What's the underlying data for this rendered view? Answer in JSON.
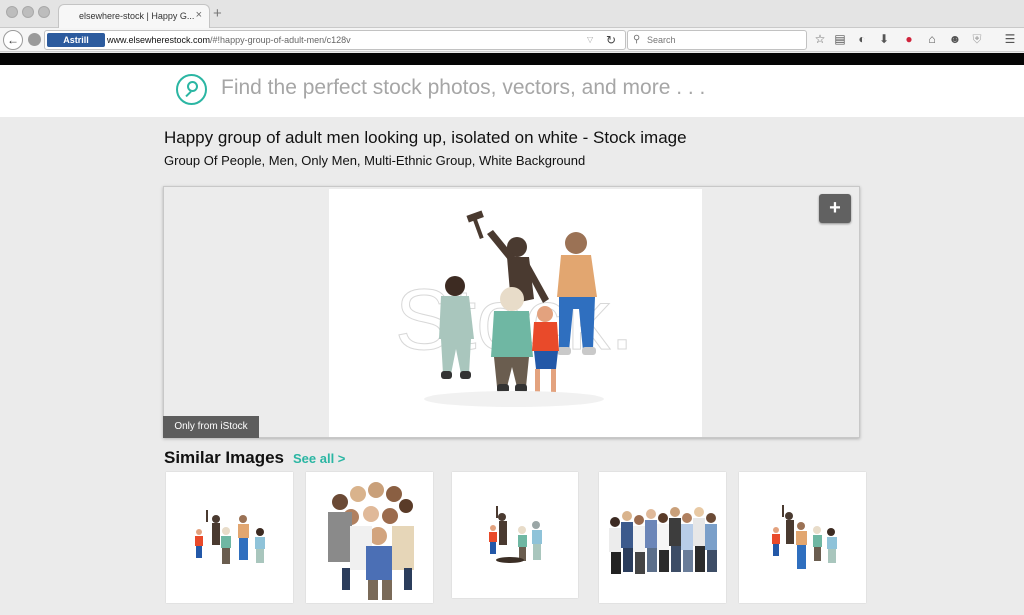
{
  "browser": {
    "tab_title": "elsewhere-stock | Happy G...",
    "tab_close": "×",
    "new_tab": "+",
    "url_host": "www.elsewherestock.com",
    "url_path": "/#!happy-group-of-adult-men/c128v",
    "vpn_badge": "Astrill",
    "search_placeholder": "Search",
    "icons": [
      "back-icon",
      "globe-icon",
      "reload-icon",
      "search-icon",
      "star-icon",
      "reading-list-icon",
      "pocket-icon",
      "download-icon",
      "vpn-icon",
      "home-icon",
      "emoji-icon",
      "shield-icon",
      "menu-icon"
    ]
  },
  "site": {
    "search_placeholder": "Find the perfect stock photos, vectors, and more . . .",
    "accent": "#2bb6a3"
  },
  "image": {
    "title": "Happy group of adult men looking up, isolated on white - Stock image",
    "keywords": "Group Of People, Men, Only Men, Multi-Ethnic Group, White Background",
    "watermark": "Stock.",
    "badge": "Only from iStock",
    "expand_label": "+"
  },
  "similar": {
    "heading": "Similar Images",
    "see_all": "See all >"
  }
}
